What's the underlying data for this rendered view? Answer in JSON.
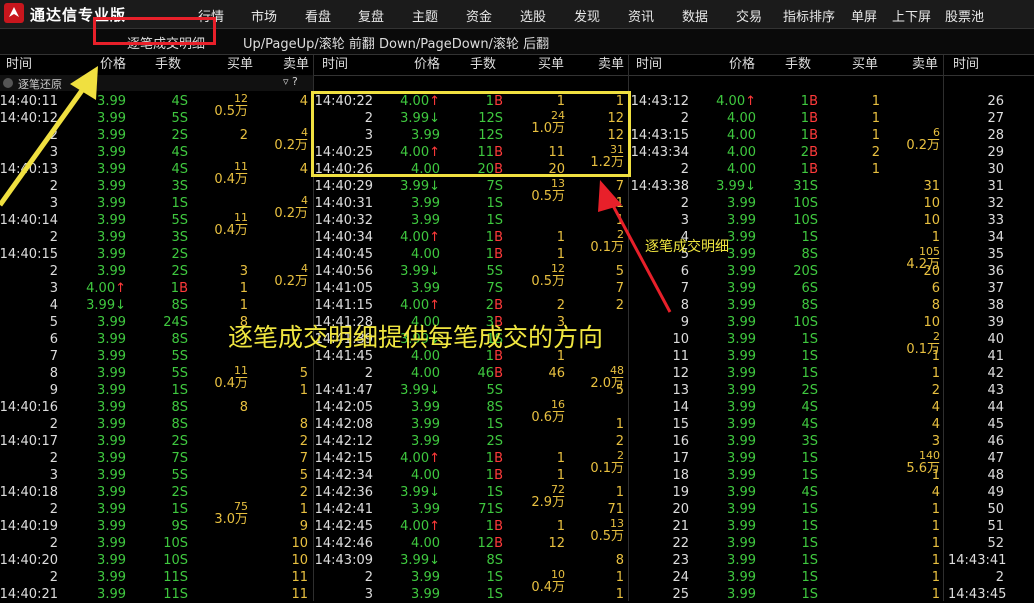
{
  "app": {
    "title": "通达信专业版"
  },
  "menu": [
    "行情",
    "市场",
    "看盘",
    "复盘",
    "主题",
    "资金",
    "选股",
    "发现",
    "资讯",
    "数据",
    "交易",
    "指标排序",
    "单屏",
    "上下屏",
    "股票池"
  ],
  "subbar": {
    "tab": "逐笔成交明细",
    "hint": "Up/PageUp/滚轮 前翻 Down/PageDown/滚轮 后翻"
  },
  "header": [
    "时间",
    "价格",
    "手数",
    "买单",
    "卖单",
    "时间",
    "价格",
    "手数",
    "买单",
    "卖单",
    "时间",
    "价格",
    "手数",
    "买单",
    "卖单",
    "时间"
  ],
  "subheader": {
    "label": "逐笔还原",
    "sym": "▿ ?"
  },
  "annotations": {
    "main": "逐笔成交明细提供每笔成交的方向",
    "side": "逐笔成交明细"
  },
  "colors": {
    "up": "#ff3a3a",
    "down": "#3fc83f",
    "order": "#e8c040",
    "highlight": "#f0e040",
    "box": "#e8202a"
  },
  "col1": {
    "time": [
      "14:40:11",
      "14:40:12",
      "2",
      "3",
      "14:40:13",
      "2",
      "3",
      "14:40:14",
      "2",
      "14:40:15",
      "2",
      "3",
      "4",
      "5",
      "6",
      "7",
      "8",
      "9",
      "14:40:16",
      "2",
      "14:40:17",
      "2",
      "3",
      "14:40:18",
      "2",
      "14:40:19",
      "2",
      "14:40:20",
      "2",
      "14:40:21"
    ],
    "price": [
      "3.99",
      "3.99",
      "3.99",
      "3.99",
      "3.99",
      "3.99",
      "3.99",
      "3.99",
      "3.99",
      "3.99",
      "3.99",
      "4.00↑",
      "3.99↓",
      "3.99",
      "3.99",
      "3.99",
      "3.99",
      "3.99",
      "3.99",
      "3.99",
      "3.99",
      "3.99",
      "3.99",
      "3.99",
      "3.99",
      "3.99",
      "3.99",
      "3.99",
      "3.99",
      "3.99"
    ],
    "vol": [
      "4S",
      "5S",
      "2S",
      "4S",
      "4S",
      "3S",
      "1S",
      "5S",
      "3S",
      "2S",
      "2S",
      "1B",
      "8S",
      "24S",
      "8S",
      "5S",
      "5S",
      "1S",
      "8S",
      "8S",
      "2S",
      "7S",
      "5S",
      "2S",
      "1S",
      "9S",
      "10S",
      "10S",
      "11S",
      "11S"
    ],
    "buy": [
      "12|0.5万",
      "",
      "2",
      "",
      "11|0.4万",
      "",
      "",
      "11|0.4万",
      "",
      "",
      "3",
      "1",
      "1",
      "8",
      "",
      "",
      "11|0.4万",
      "",
      "8",
      "",
      "",
      "",
      "",
      "",
      "75|3.0万",
      "",
      "",
      "",
      "",
      ""
    ],
    "sell": [
      "4",
      "",
      "4|0.2万",
      "",
      "4",
      "",
      "4|0.2万",
      "",
      "",
      "",
      "4|0.2万",
      "",
      "",
      "",
      "",
      "",
      "5",
      "1",
      "",
      "8",
      "2",
      "7",
      "5",
      "2",
      "1",
      "9",
      "10",
      "10",
      "11",
      "11"
    ]
  },
  "col2": {
    "time": [
      "14:40:22",
      "2",
      "3",
      "14:40:25",
      "14:40:26",
      "14:40:29",
      "14:40:31",
      "14:40:32",
      "14:40:34",
      "14:40:45",
      "14:40:56",
      "14:41:05",
      "14:41:15",
      "14:41:28",
      "14:41:39",
      "14:41:45",
      "2",
      "14:41:47",
      "14:42:05",
      "14:42:08",
      "14:42:12",
      "14:42:15",
      "14:42:34",
      "14:42:36",
      "14:42:41",
      "14:42:45",
      "14:42:46",
      "14:43:09",
      "2",
      "3"
    ],
    "price": [
      "4.00↑",
      "3.99↓",
      "3.99",
      "4.00↑",
      "4.00",
      "3.99↓",
      "3.99",
      "3.99",
      "4.00↑",
      "4.00",
      "3.99↓",
      "3.99",
      "4.00↑",
      "4.00",
      "3.99↓",
      "4.00",
      "4.00",
      "3.99↓",
      "3.99",
      "3.99",
      "3.99",
      "4.00↑",
      "4.00",
      "3.99↓",
      "3.99",
      "4.00↑",
      "4.00",
      "3.99↓",
      "3.99",
      "3.99"
    ],
    "vol": [
      "1B",
      "12S",
      "12S",
      "11B",
      "20B",
      "7S",
      "1S",
      "1S",
      "1B",
      "1B",
      "5S",
      "7S",
      "2B",
      "3B",
      "1S",
      "1B",
      "46B",
      "5S",
      "8S",
      "1S",
      "2S",
      "1B",
      "1B",
      "1S",
      "71S",
      "1B",
      "12B",
      "8S",
      "1S",
      "1S"
    ],
    "buy": [
      "1",
      "24|1.0万",
      "",
      "11",
      "20",
      "13|0.5万",
      "",
      "",
      "1",
      "1",
      "12|0.5万",
      "",
      "2",
      "3",
      "",
      "1",
      "46",
      "",
      "16|0.6万",
      "",
      "",
      "1",
      "1",
      "72|2.9万",
      "",
      "1",
      "12",
      "",
      "10|0.4万",
      ""
    ],
    "sell": [
      "1",
      "12",
      "12",
      "31|1.2万",
      "",
      "7",
      "1",
      "1",
      "2|0.1万",
      "",
      "5",
      "7",
      "2",
      "",
      "",
      "",
      "48|2.0万",
      "5",
      "",
      "1",
      "2",
      "2|0.1万",
      "",
      "1",
      "71",
      "13|0.5万",
      "",
      "8",
      "1",
      "1"
    ]
  },
  "col3": {
    "time": [
      "14:43:12",
      "2",
      "14:43:15",
      "14:43:34",
      "2",
      "14:43:38",
      "2",
      "3",
      "4",
      "5",
      "6",
      "7",
      "8",
      "9",
      "10",
      "11",
      "12",
      "13",
      "14",
      "15",
      "16",
      "17",
      "18",
      "19",
      "20",
      "21",
      "22",
      "23",
      "24",
      "25"
    ],
    "price": [
      "4.00↑",
      "4.00",
      "4.00",
      "4.00",
      "4.00",
      "3.99↓",
      "3.99",
      "3.99",
      "3.99",
      "3.99",
      "3.99",
      "3.99",
      "3.99",
      "3.99",
      "3.99",
      "3.99",
      "3.99",
      "3.99",
      "3.99",
      "3.99",
      "3.99",
      "3.99",
      "3.99",
      "3.99",
      "3.99",
      "3.99",
      "3.99",
      "3.99",
      "3.99",
      "3.99"
    ],
    "vol": [
      "1B",
      "1B",
      "1B",
      "2B",
      "1B",
      "31S",
      "10S",
      "10S",
      "1S",
      "8S",
      "20S",
      "6S",
      "8S",
      "10S",
      "1S",
      "1S",
      "1S",
      "2S",
      "4S",
      "4S",
      "3S",
      "1S",
      "1S",
      "4S",
      "1S",
      "1S",
      "1S",
      "1S",
      "1S",
      "1S"
    ],
    "buy": [
      "1",
      "1",
      "1",
      "2",
      "1",
      "",
      "",
      "",
      "",
      "",
      "",
      "",
      "",
      "",
      "",
      "",
      "",
      "",
      "",
      "",
      "",
      "",
      "",
      "",
      "",
      "",
      "",
      "",
      "",
      ""
    ],
    "sell": [
      "",
      "",
      "6|0.2万",
      "",
      "",
      "31",
      "10",
      "10",
      "1",
      "105|4.2万",
      "20",
      "6",
      "8",
      "10",
      "2|0.1万",
      "1",
      "1",
      "2",
      "4",
      "4",
      "3",
      "140|5.6万",
      "1",
      "4",
      "1",
      "1",
      "1",
      "1",
      "1",
      "1"
    ]
  },
  "col4": {
    "time": [
      "26",
      "27",
      "28",
      "29",
      "30",
      "31",
      "32",
      "33",
      "34",
      "35",
      "36",
      "37",
      "38",
      "39",
      "40",
      "41",
      "42",
      "43",
      "44",
      "45",
      "46",
      "47",
      "48",
      "49",
      "50",
      "51",
      "52",
      "14:43:41",
      "2",
      "14:43:45"
    ]
  }
}
